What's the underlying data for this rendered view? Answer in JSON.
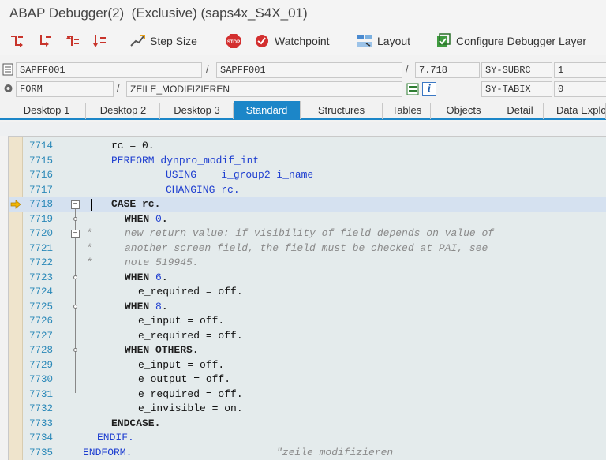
{
  "window": {
    "title": "ABAP Debugger(2)  (Exclusive) (saps4x_S4X_01)"
  },
  "toolbar": {
    "step_size_label": "Step Size",
    "watchpoint_label": "Watchpoint",
    "layout_label": "Layout",
    "configure_label": "Configure Debugger Layer"
  },
  "fields": {
    "program": "SAPFF001",
    "include": "SAPFF001",
    "line": "7.718",
    "subrc_label": "SY-SUBRC",
    "subrc_value": "1",
    "event_type": "FORM",
    "event_name": "ZEILE_MODIFIZIEREN",
    "tabix_label": "SY-TABIX",
    "tabix_value": "0",
    "info_icon_text": "i"
  },
  "tabs": [
    "Desktop 1",
    "Desktop 2",
    "Desktop 3",
    "Standard",
    "Structures",
    "Tables",
    "Objects",
    "Detail",
    "Data Explo"
  ],
  "active_tab": "Standard",
  "editor": {
    "current_line": "7718",
    "line_numbers": [
      "7714",
      "7715",
      "7716",
      "7717",
      "7718",
      "7719",
      "7720",
      "7721",
      "7722",
      "7723",
      "7724",
      "7725",
      "7726",
      "7727",
      "7728",
      "7729",
      "7730",
      "7731",
      "7732",
      "7733",
      "7734",
      "7735"
    ],
    "code": [
      "rc = 0.",
      "PERFORM dynpro_modif_int",
      "USING    i_group2 i_name",
      "CHANGING rc.",
      "CASE rc.",
      "WHEN 0.",
      "new return value: if visibility of field depends on value of",
      "another screen field, the field must be checked at PAI, see",
      "note 519945.",
      "WHEN 6.",
      "e_required = off.",
      "WHEN 8.",
      "e_input = off.",
      "e_required = off.",
      "WHEN OTHERS.",
      "e_input = off.",
      "e_output = off.",
      "e_required = off.",
      "e_invisible = on.",
      "ENDCASE.",
      "ENDIF.",
      "ENDFORM.",
      "\"zeile modifizieren"
    ]
  },
  "colors": {
    "accent": "#1c86c8",
    "keyword": "#1f3fd0",
    "line_number": "#2a88b8",
    "comment": "#8a8a8a",
    "editor_bg": "#e4ebec"
  }
}
